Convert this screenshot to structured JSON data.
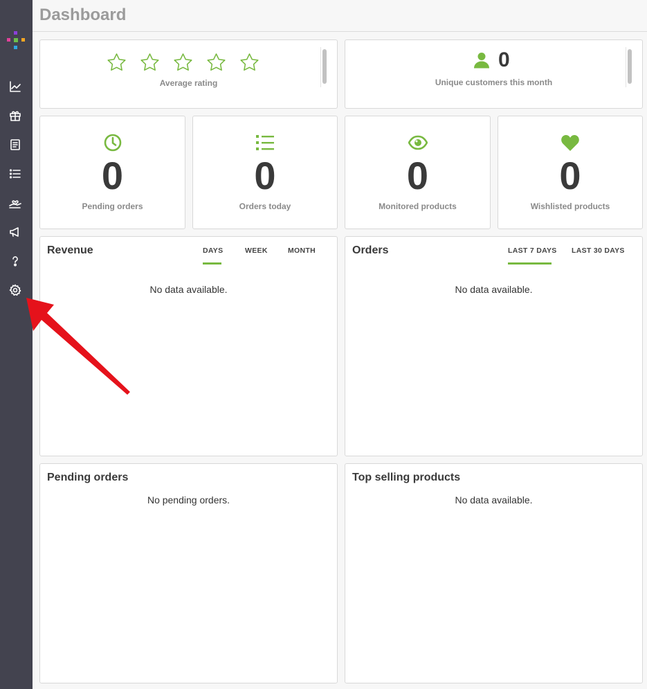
{
  "page": {
    "title": "Dashboard"
  },
  "sidebar": {
    "items": [
      {
        "name": "statistics",
        "icon": "chart-line-icon"
      },
      {
        "name": "products",
        "icon": "gift-box-icon"
      },
      {
        "name": "orders",
        "icon": "receipt-icon"
      },
      {
        "name": "lists",
        "icon": "list-icon"
      },
      {
        "name": "customers",
        "icon": "hand-heart-icon"
      },
      {
        "name": "marketing",
        "icon": "megaphone-icon"
      },
      {
        "name": "help",
        "icon": "question-icon"
      },
      {
        "name": "settings",
        "icon": "gear-icon"
      }
    ]
  },
  "rating": {
    "label": "Average rating",
    "stars_filled": 0,
    "stars_total": 5
  },
  "customers": {
    "value": "0",
    "label": "Unique customers this month"
  },
  "stats": [
    {
      "value": "0",
      "label": "Pending orders",
      "icon": "clock-icon"
    },
    {
      "value": "0",
      "label": "Orders today",
      "icon": "list-icon"
    },
    {
      "value": "0",
      "label": "Monitored products",
      "icon": "eye-icon"
    },
    {
      "value": "0",
      "label": "Wishlisted products",
      "icon": "heart-icon"
    }
  ],
  "revenue": {
    "title": "Revenue",
    "tabs": [
      "DAYS",
      "WEEK",
      "MONTH"
    ],
    "active_tab": "DAYS",
    "empty": "No data available."
  },
  "orders": {
    "title": "Orders",
    "tabs": [
      "LAST 7 DAYS",
      "LAST 30 DAYS"
    ],
    "active_tab": "LAST 7 DAYS",
    "empty": "No data available."
  },
  "pending": {
    "title": "Pending orders",
    "empty": "No pending orders."
  },
  "top_selling": {
    "title": "Top selling products",
    "empty": "No data available."
  },
  "colors": {
    "accent": "#78b940",
    "sidebar": "#43434f",
    "annotation_arrow": "#e5121b"
  }
}
